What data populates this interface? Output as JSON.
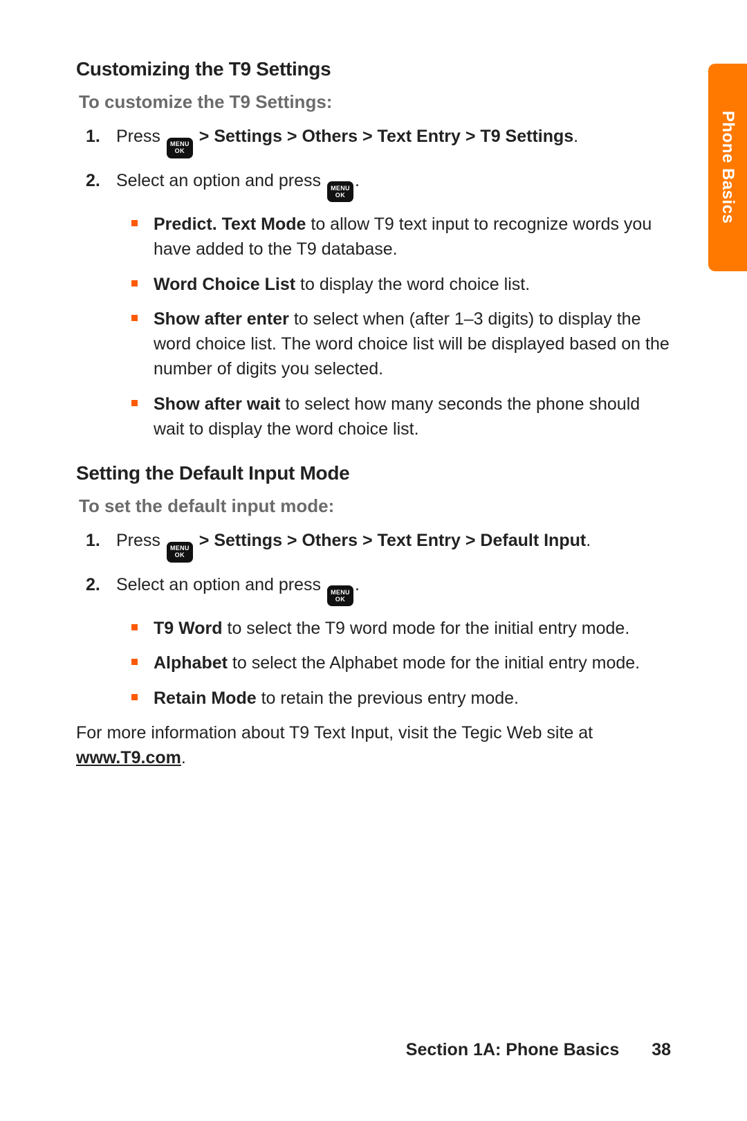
{
  "sideTab": {
    "label": "Phone Basics"
  },
  "menuKey": {
    "line1": "MENU",
    "line2": "OK"
  },
  "section1": {
    "heading": "Customizing the T9 Settings",
    "subhead": "To customize the T9 Settings:",
    "steps": {
      "s1_press": "Press ",
      "s1_pathBold": " > Settings > Others > Text Entry > T9 Settings",
      "s2_text": "Select an option and press "
    },
    "bullets": {
      "b1_bold": "Predict. Text Mode",
      "b1_rest": " to allow T9 text input to recognize words you have added to the T9 database.",
      "b2_bold": "Word Choice List",
      "b2_rest": " to display the word choice list.",
      "b3_bold": "Show after enter",
      "b3_rest": " to select when (after 1–3 digits) to display the word choice list. The word choice list will be displayed based on the number of digits you selected.",
      "b4_bold": "Show after wait",
      "b4_rest": " to select how many seconds the phone should wait to display the word choice list."
    }
  },
  "section2": {
    "heading": "Setting the Default Input Mode",
    "subhead": "To set the default input mode:",
    "steps": {
      "s1_press": "Press ",
      "s1_pathBold": " > Settings > Others > Text Entry > Default Input",
      "s2_text": "Select an option and press "
    },
    "bullets": {
      "b1_bold": "T9 Word",
      "b1_rest": " to select the T9 word mode for the initial entry mode.",
      "b2_bold": "Alphabet",
      "b2_rest": " to select the Alphabet mode for the initial entry mode.",
      "b3_bold": "Retain Mode",
      "b3_rest": " to retain the previous entry mode."
    }
  },
  "closing": {
    "pre": "For more information about T9 Text Input, visit the Tegic Web site at ",
    "link": "www.T9.com",
    "post": "."
  },
  "footer": {
    "section": "Section 1A: Phone Basics",
    "page": "38"
  }
}
